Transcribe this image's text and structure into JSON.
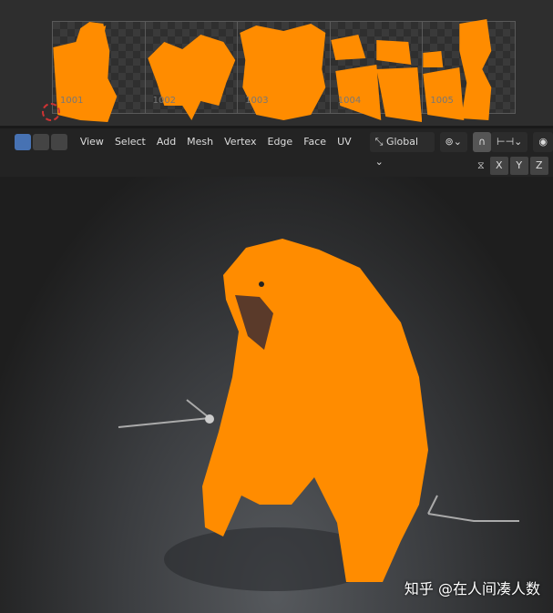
{
  "uv_editor": {
    "tiles": [
      "1001",
      "1002",
      "1003",
      "1004",
      "1005"
    ]
  },
  "header": {
    "menu": [
      "View",
      "Select",
      "Add",
      "Mesh",
      "Vertex",
      "Edge",
      "Face",
      "UV"
    ],
    "orientation": "Global",
    "axes": [
      "X",
      "Y",
      "Z"
    ]
  },
  "colors": {
    "selection": "#ff8c00",
    "select_mode_active": "#4772b3"
  },
  "watermark": "知乎 @在人间凑人数"
}
